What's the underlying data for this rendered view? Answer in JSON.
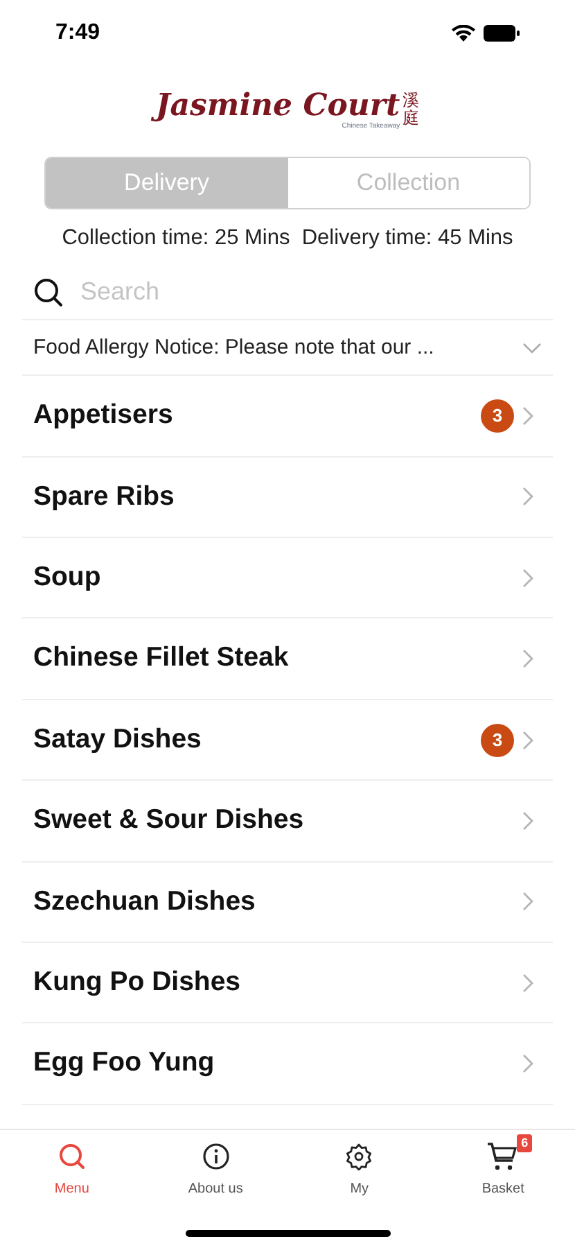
{
  "status_bar": {
    "time": "7:49"
  },
  "logo": {
    "name": "Jasmine Court",
    "chinese": "溪庭",
    "subtitle": "Chinese Takeaway"
  },
  "order_type": [
    {
      "label": "Delivery",
      "selected": true
    },
    {
      "label": "Collection",
      "selected": false
    }
  ],
  "times": "Collection time: 25 Mins  Delivery time: 45 Mins",
  "search": {
    "placeholder": "Search"
  },
  "notice": {
    "text": "Food Allergy Notice: Please note that our ...",
    "expanded": false
  },
  "categories": [
    {
      "name": "Appetisers",
      "count": "3"
    },
    {
      "name": "Spare Ribs"
    },
    {
      "name": "Soup"
    },
    {
      "name": "Chinese Fillet Steak"
    },
    {
      "name": "Satay Dishes",
      "count": "3"
    },
    {
      "name": "Sweet & Sour Dishes"
    },
    {
      "name": "Szechuan Dishes"
    },
    {
      "name": "Kung Po Dishes"
    },
    {
      "name": "Egg Foo Yung"
    }
  ],
  "tab_bar": [
    {
      "label": "Menu",
      "kind": "menu",
      "selected": true
    },
    {
      "label": "About us",
      "kind": "about",
      "selected": false
    },
    {
      "label": "My",
      "kind": "my",
      "selected": false
    },
    {
      "label": "Basket",
      "kind": "basket",
      "selected": false,
      "badge": "6"
    }
  ]
}
